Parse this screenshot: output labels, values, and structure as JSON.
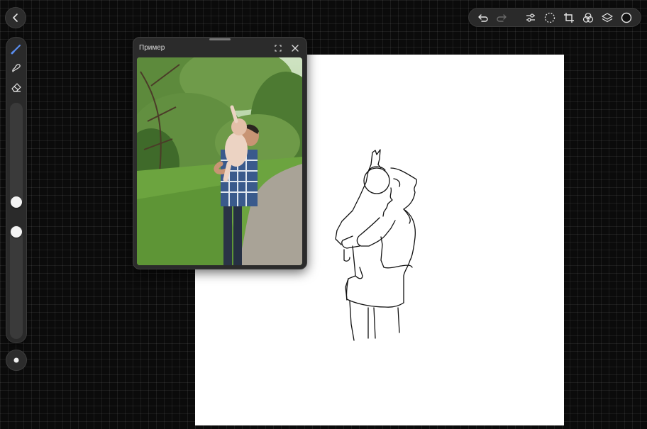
{
  "reference_window": {
    "title": "Пример"
  },
  "toolbar": {
    "left_tools": [
      "back-icon"
    ],
    "right_tools": [
      "undo-icon",
      "redo-icon",
      "adjustments-icon",
      "selection-icon",
      "transform-icon",
      "blend-icon",
      "layers-icon",
      "color-icon"
    ]
  },
  "sidebar": {
    "tools": [
      "brush-icon",
      "smudge-icon",
      "eraser-icon"
    ],
    "brush_size_level": 0.55,
    "opacity_level": 0.45
  },
  "colors": {
    "background": "#0b0b0b",
    "panel": "#2a2a2a",
    "accent": "#5a8dee",
    "canvas": "#ffffff",
    "current_color": "#111111"
  }
}
